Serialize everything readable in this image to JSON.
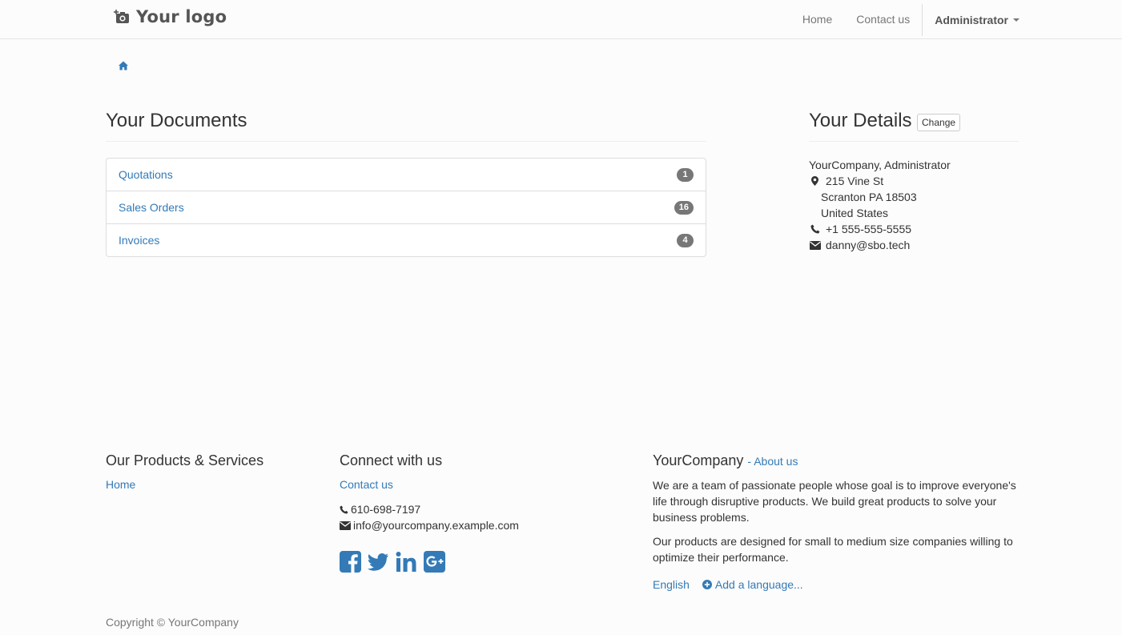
{
  "navbar": {
    "logo_text": "Your logo",
    "links": [
      "Home",
      "Contact us"
    ],
    "user_menu": "Administrator"
  },
  "documents": {
    "title": "Your Documents",
    "items": [
      {
        "label": "Quotations",
        "count": "1"
      },
      {
        "label": "Sales Orders",
        "count": "16"
      },
      {
        "label": "Invoices",
        "count": "4"
      }
    ]
  },
  "details": {
    "title": "Your Details",
    "change_label": "Change",
    "name": "YourCompany, Administrator",
    "street": "215 Vine St",
    "city": "Scranton PA 18503",
    "country": "United States",
    "phone": "+1 555-555-5555",
    "email": "danny@sbo.tech"
  },
  "footer": {
    "products": {
      "title": "Our Products & Services",
      "home_link": "Home"
    },
    "connect": {
      "title": "Connect with us",
      "contact_link": "Contact us",
      "phone": "610-698-7197",
      "email": "info@yourcompany.example.com",
      "social": [
        "facebook-icon",
        "twitter-icon",
        "linkedin-icon",
        "google-plus-icon"
      ]
    },
    "company": {
      "title": "YourCompany",
      "about_link": "- About us",
      "para1": "We are a team of passionate people whose goal is to improve everyone's life through disruptive products. We build great products to solve your business problems.",
      "para2": "Our products are designed for small to medium size companies willing to optimize their performance.",
      "language": "English",
      "add_language": "Add a language..."
    },
    "copyright": "Copyright © YourCompany"
  },
  "colors": {
    "link": "#337ab7",
    "badge": "#777777",
    "text": "#333333"
  }
}
